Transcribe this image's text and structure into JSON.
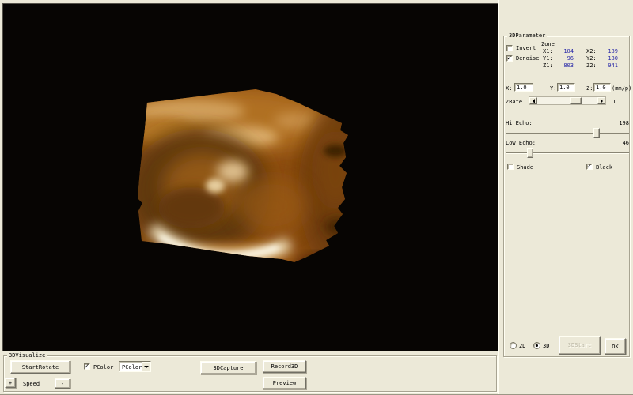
{
  "colors": {
    "panel_bg": "#ECE9D8",
    "viewport_bg": "#070503",
    "value_blue": "#2828A8",
    "us_base": "#8C4C10",
    "us_dark": "#5E3808",
    "us_light": "#B06F24",
    "us_crescent": "#FFFDF0"
  },
  "parameter_panel": {
    "title": "3DParameter",
    "invert_label": "Invert",
    "denoise_label": "Denoise",
    "zone": {
      "label": "Zone",
      "rows": [
        {
          "l1": "X1:",
          "v1": "104",
          "l2": "X2:",
          "v2": "189"
        },
        {
          "l1": "Y1:",
          "v1": "96",
          "l2": "Y2:",
          "v2": "180"
        },
        {
          "l1": "Z1:",
          "v1": "803",
          "l2": "Z2:",
          "v2": "941"
        }
      ]
    },
    "scale": {
      "x_label": "X:",
      "x_value": "1.0",
      "y_label": "Y:",
      "y_value": "1.0",
      "z_label": "Z:",
      "z_value": "1.0",
      "unit": "(mm/p)"
    },
    "zrate": {
      "label": "ZRate",
      "value": "1"
    },
    "hi_echo": {
      "label": "Hi Echo:",
      "value": "198"
    },
    "low_echo": {
      "label": "Low Echo:",
      "value": "46"
    },
    "shade_label": "Shade",
    "black_label": "Black",
    "mode_2d_label": "2D",
    "mode_3d_label": "3D",
    "start3d_label": "3DStart",
    "ok_label": "OK"
  },
  "visualize_panel": {
    "title": "3DVisualize",
    "start_rotate_label": "StartRotate",
    "speed_plus_label": "+",
    "speed_label": "Speed",
    "speed_minus_label": "-",
    "pcolor_checkbox_label": "PColor",
    "pcolor_dropdown_value": "PColor",
    "capture_label": "3DCapture",
    "record_label": "Record3D",
    "preview_label": "Preview"
  }
}
